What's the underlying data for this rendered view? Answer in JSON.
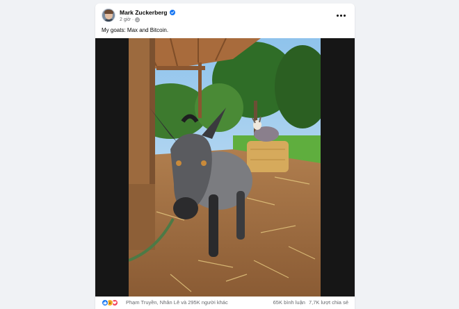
{
  "post": {
    "author": "Mark Zuckerberg",
    "time": "2 giờ",
    "separator": "·",
    "privacy_icon": "globe-icon",
    "verified_icon": "verified-badge-icon",
    "more_icon": "more-options-icon",
    "caption": "My goats: Max and Bitcoin.",
    "photo_alt": "Two goats under a wooden shelter near hay bales"
  },
  "footer": {
    "reaction_icons": [
      "like-icon",
      "haha-icon",
      "love-icon"
    ],
    "reactors": "Phạm Truyền, Nhân Lê và 295K người khác",
    "comments": "65K bình luận",
    "shares": "7,7K lượt chia sẻ"
  },
  "colors": {
    "page_bg": "#f0f2f5",
    "card_bg": "#ffffff",
    "brand_blue": "#1877f2",
    "secondary_text": "#65676b"
  }
}
